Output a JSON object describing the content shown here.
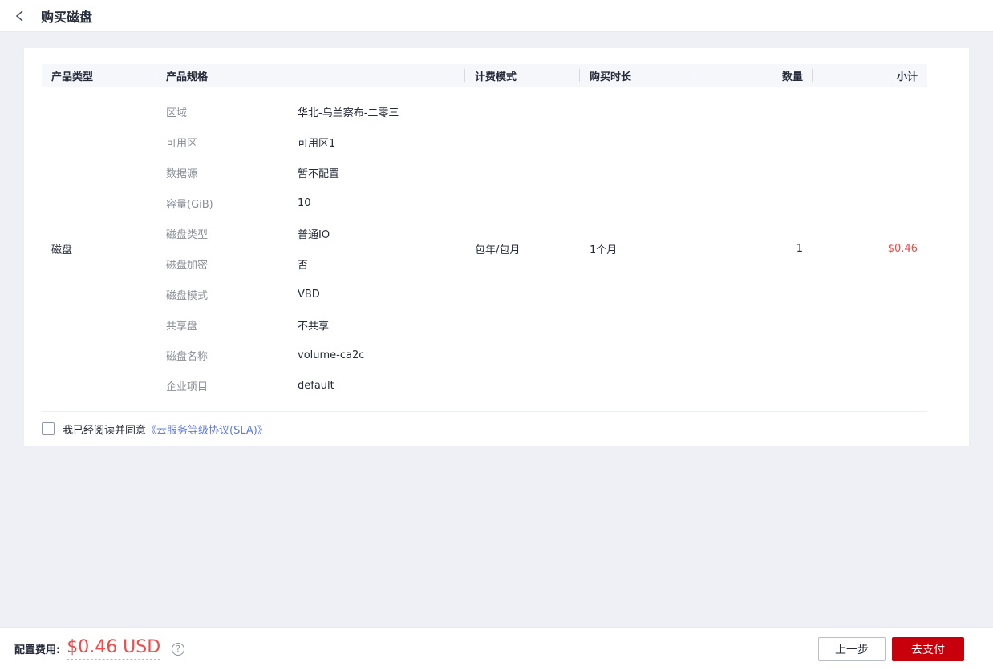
{
  "header": {
    "title": "购买磁盘"
  },
  "table": {
    "columns": [
      "产品类型",
      "产品规格",
      "计费模式",
      "购买时长",
      "数量",
      "小计"
    ],
    "row": {
      "product_type": "磁盘",
      "specs": [
        {
          "label": "区域",
          "value": "华北-乌兰察布-二零三"
        },
        {
          "label": "可用区",
          "value": "可用区1"
        },
        {
          "label": "数据源",
          "value": "暂不配置"
        },
        {
          "label": "容量(GiB)",
          "value": "10"
        },
        {
          "label": "磁盘类型",
          "value": "普通IO"
        },
        {
          "label": "磁盘加密",
          "value": "否"
        },
        {
          "label": "磁盘模式",
          "value": "VBD"
        },
        {
          "label": "共享盘",
          "value": "不共享"
        },
        {
          "label": "磁盘名称",
          "value": "volume-ca2c"
        },
        {
          "label": "企业项目",
          "value": "default"
        }
      ],
      "billing_mode": "包年/包月",
      "duration": "1个月",
      "quantity": "1",
      "subtotal": "$0.46"
    }
  },
  "agreement": {
    "checked": false,
    "text": "我已经阅读并同意",
    "link": "《云服务等级协议(SLA)》"
  },
  "footer": {
    "cost_label": "配置费用:",
    "price": "$0.46 USD",
    "help_icon": "question-mark",
    "prev_button": "上一步",
    "pay_button": "去支付"
  },
  "colors": {
    "accent_red": "#c7000b",
    "price_red": "#f04b4b",
    "link_blue": "#5e7ce0",
    "label_gray": "#8a8e99",
    "text_dark": "#252b3a",
    "page_bg": "#eef0f5",
    "table_head_bg": "#f5f7fa"
  }
}
